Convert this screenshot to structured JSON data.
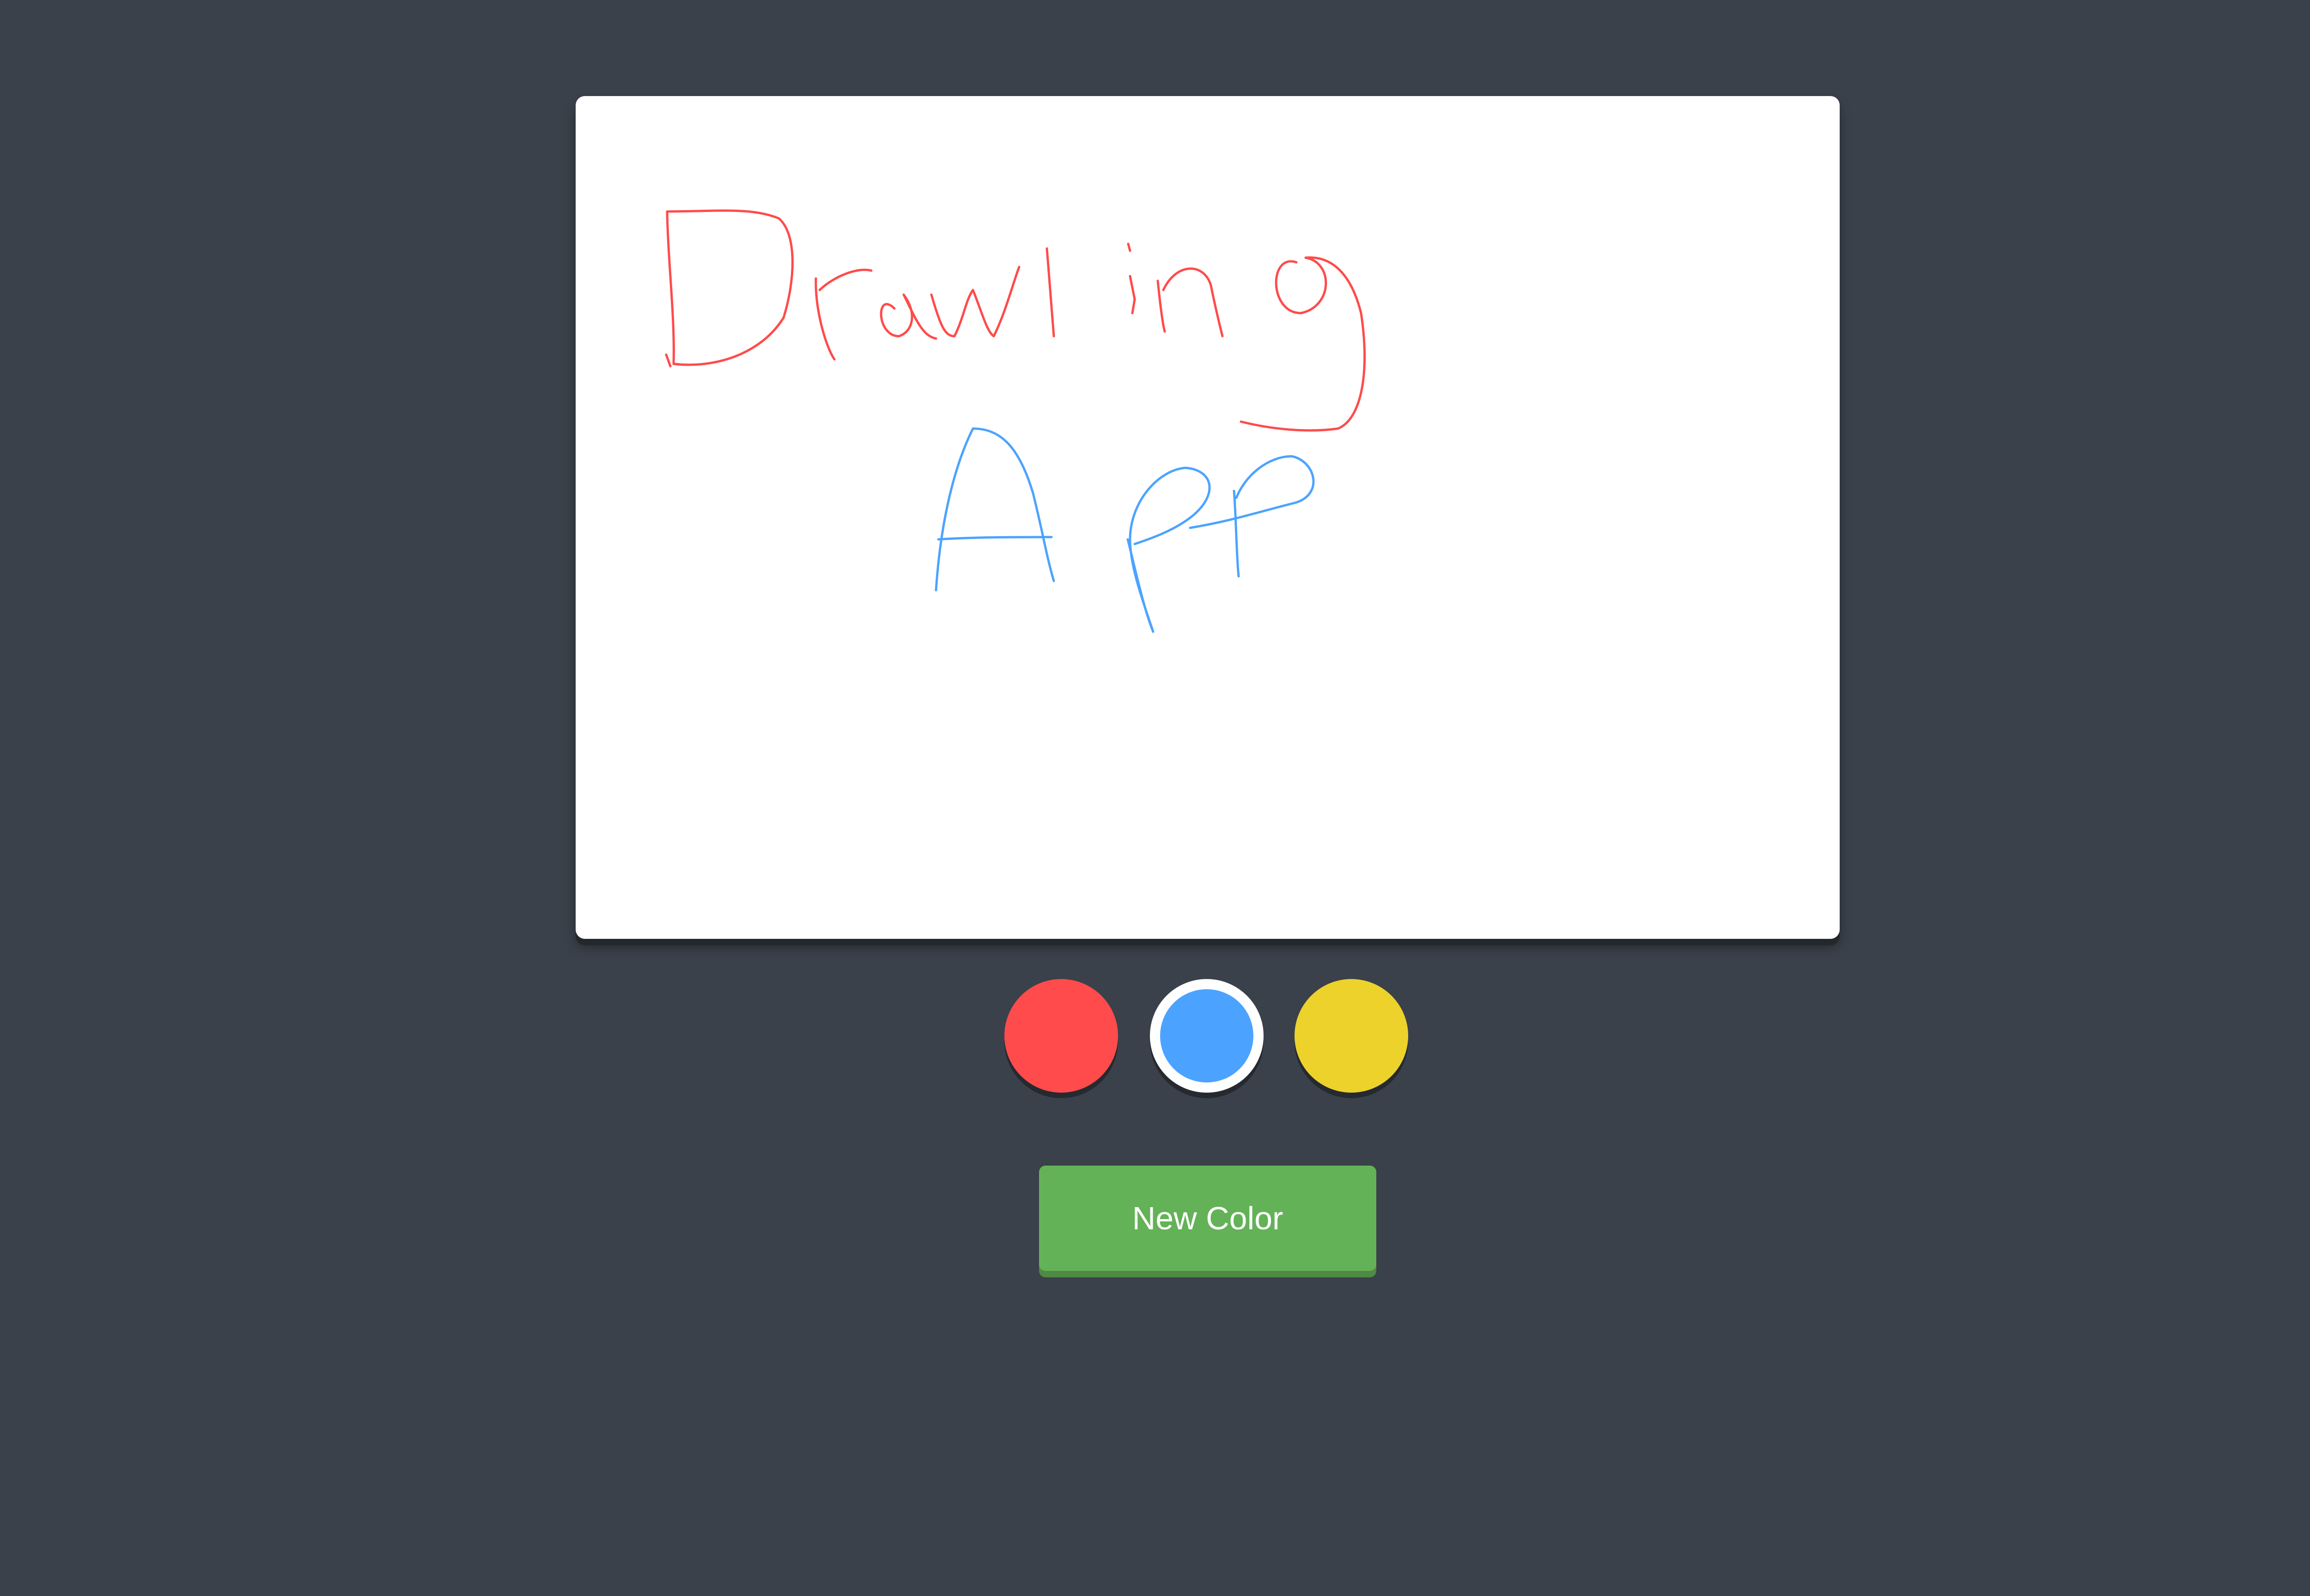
{
  "page": {
    "background_color": "#3a414a"
  },
  "canvas": {
    "background_color": "#ffffff",
    "strokes": [
      {
        "color": "#ff4b4b",
        "depicts": "handwritten-drawing"
      },
      {
        "color": "#4ca3ff",
        "depicts": "handwritten-app"
      }
    ]
  },
  "palette": {
    "swatches": [
      {
        "name": "red",
        "color": "#ff4b4b",
        "selected": false
      },
      {
        "name": "blue",
        "color": "#4ca3ff",
        "selected": true
      },
      {
        "name": "yellow",
        "color": "#edd22b",
        "selected": false
      }
    ]
  },
  "actions": {
    "new_color_label": "New Color",
    "new_color_button_color": "#64b257"
  }
}
